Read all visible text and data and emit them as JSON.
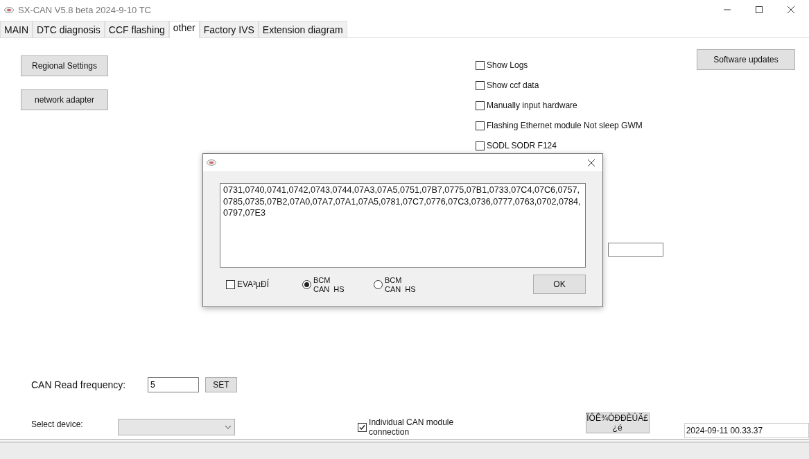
{
  "window": {
    "title": "SX-CAN V5.8 beta 2024-9-10 TC"
  },
  "tabs": [
    {
      "label": "MAIN",
      "selected": false
    },
    {
      "label": "DTC diagnosis",
      "selected": false
    },
    {
      "label": "CCF flashing",
      "selected": false
    },
    {
      "label": "other",
      "selected": true
    },
    {
      "label": "Factory IVS",
      "selected": false
    },
    {
      "label": "Extension diagram",
      "selected": false
    }
  ],
  "left_buttons": [
    "Regional Settings",
    "network adapter"
  ],
  "options": [
    {
      "label": "Show Logs",
      "checked": false
    },
    {
      "label": "Show ccf data",
      "checked": false
    },
    {
      "label": "Manually input hardware",
      "checked": false
    },
    {
      "label": "Flashing Ethernet module Not sleep GWM",
      "checked": false
    },
    {
      "label": "SODL SODR F124",
      "checked": false
    }
  ],
  "software_updates_button": "Software updates",
  "can_read": {
    "label": "CAN Read frequency:",
    "value": "5",
    "button": "SET"
  },
  "device": {
    "label": "Select device:"
  },
  "individual_can": {
    "label": "Individual CAN module connection",
    "checked": true
  },
  "module_button": "ÏÔÊ¾ÓÐÐÈÙÄ£¿é",
  "timestamp": "2024-09-11 00.33.37",
  "dialog": {
    "text": "0731,0740,0741,0742,0743,0744,07A3,07A5,0751,07B7,0775,07B1,0733,07C4,07C6,0757,0785,0735,07B2,07A0,07A7,07A1,07A5,0781,07C7,0776,07C3,0736,0777,0763,0702,0784,0797,07E3",
    "checkbox": {
      "label": "EVA³µÐÍ",
      "checked": false
    },
    "radios": [
      {
        "line_1": "BCM",
        "line_2": "CAN  HS",
        "selected": true
      },
      {
        "line_1": "BCM",
        "line_2": "CAN  HS",
        "selected": false
      }
    ],
    "ok_button": "OK"
  }
}
